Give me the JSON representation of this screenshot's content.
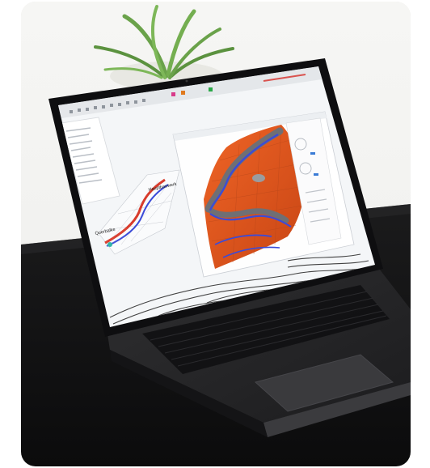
{
  "photo": {
    "subject": "laptop-with-terrain-mesh-software",
    "map_labels": {
      "left": "Querbalke",
      "right": "Hauptbauwerk"
    },
    "colors": {
      "background": "#f3f3f1",
      "desk": "#111111",
      "laptop_body": "#2a2a2c",
      "screen_bezel": "#0e0e10",
      "app_bg": "#f4f6f8",
      "terrain_orange": "#e0561f",
      "river_blue": "#3b4bd8",
      "plant_green": "#5f9b3c"
    }
  }
}
